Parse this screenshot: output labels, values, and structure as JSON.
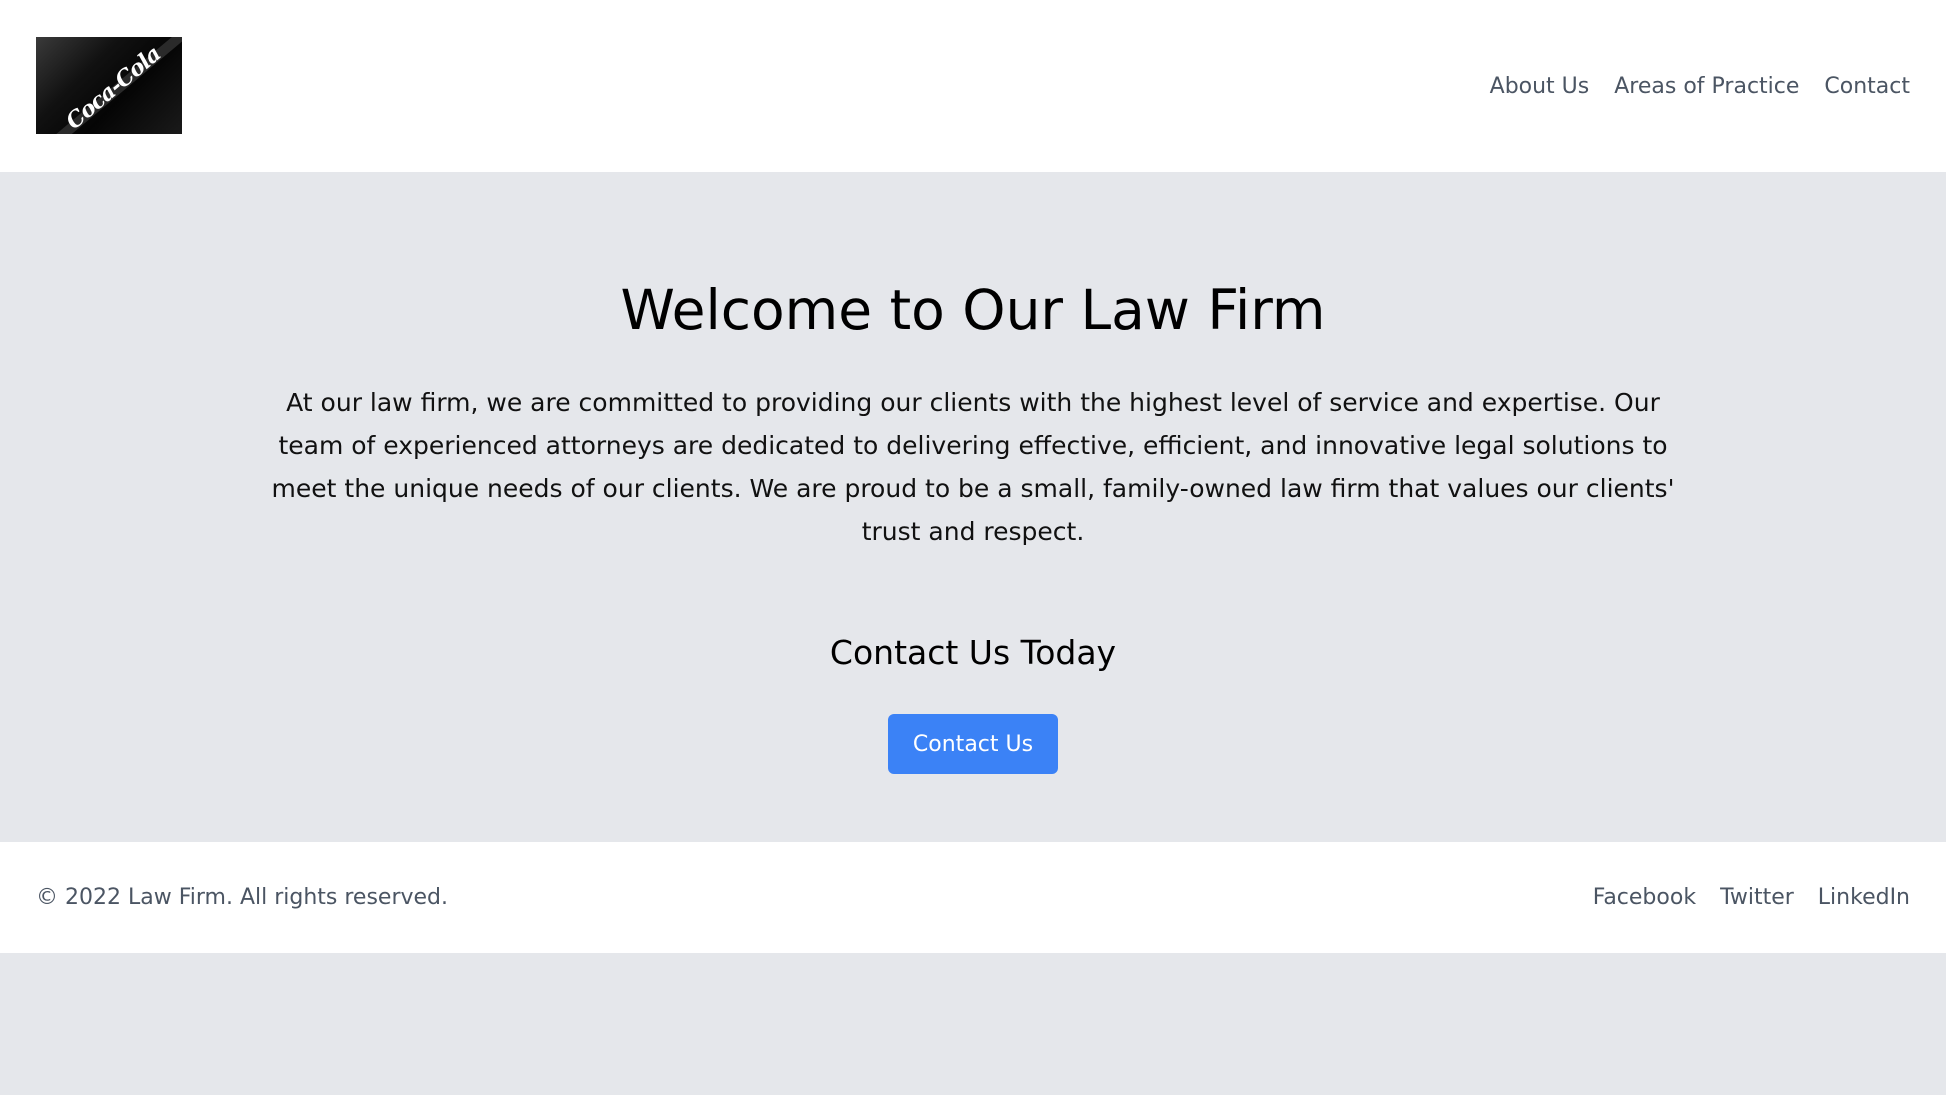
{
  "header": {
    "logo_alt": "Coca-Cola logo image",
    "logo_text": "Coca-Cola",
    "nav": [
      {
        "label": "About Us"
      },
      {
        "label": "Areas of Practice"
      },
      {
        "label": "Contact"
      }
    ]
  },
  "hero": {
    "title": "Welcome to Our Law Firm",
    "description": "At our law firm, we are committed to providing our clients with the highest level of service and expertise. Our team of experienced attorneys are dedicated to delivering effective, efficient, and innovative legal solutions to meet the unique needs of our clients. We are proud to be a small, family-owned law firm that values our clients' trust and respect.",
    "cta_heading": "Contact Us Today",
    "cta_button": "Contact Us"
  },
  "footer": {
    "copyright": "© 2022 Law Firm. All rights reserved.",
    "social": [
      {
        "label": "Facebook"
      },
      {
        "label": "Twitter"
      },
      {
        "label": "LinkedIn"
      }
    ]
  },
  "colors": {
    "accent": "#3b82f6",
    "background": "#e5e7eb",
    "nav_text": "#4b5563"
  }
}
